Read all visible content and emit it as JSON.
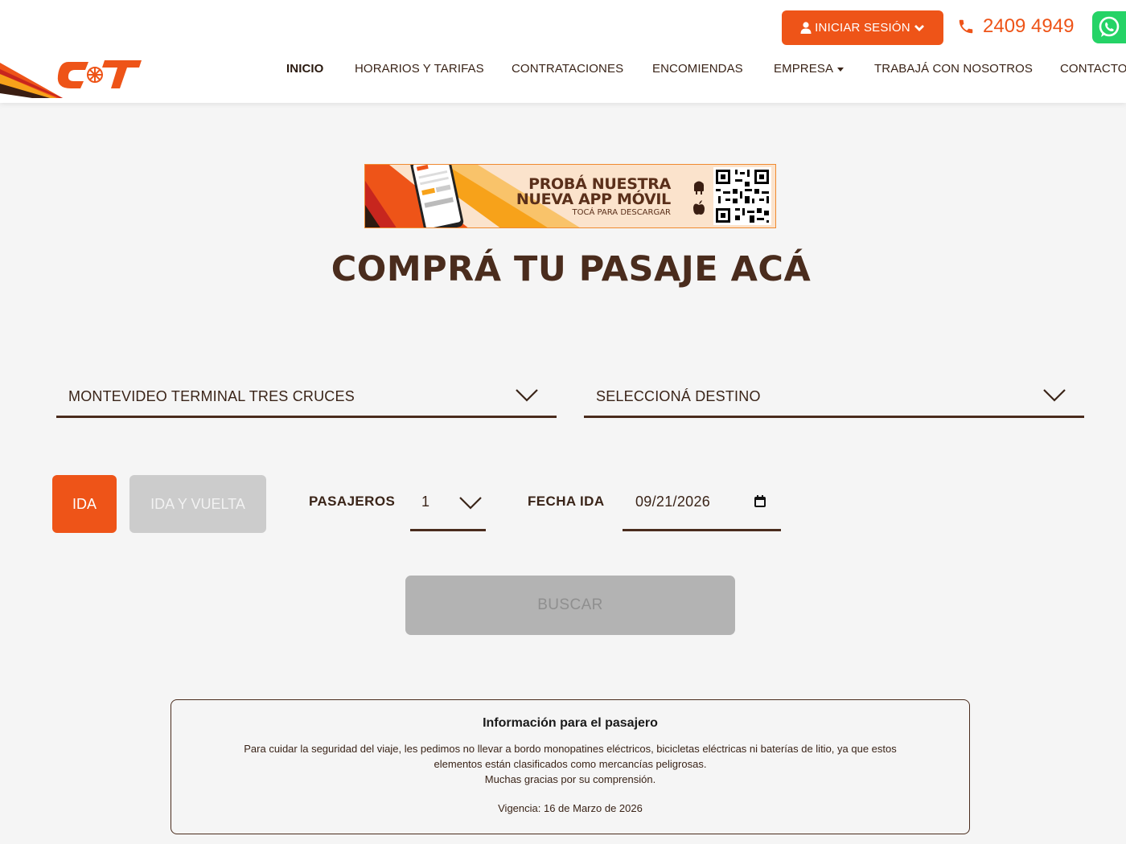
{
  "header": {
    "login_label": "INICIAR SESIÓN",
    "phone": "2409 4949",
    "nav": [
      {
        "label": "INICIO",
        "active": true
      },
      {
        "label": "HORARIOS Y TARIFAS"
      },
      {
        "label": "CONTRATACIONES"
      },
      {
        "label": "ENCOMIENDAS"
      },
      {
        "label": "EMPRESA"
      },
      {
        "label": "TRABAJÁ CON NOSOTROS"
      },
      {
        "label": "CONTACTO"
      }
    ]
  },
  "banner": {
    "title_line1": "PROBÁ NUESTRA",
    "title_line2": "NUEVA APP MÓVIL",
    "subtitle": "TOCÁ PARA DESCARGAR"
  },
  "main": {
    "title": "COMPRÁ TU PASAJE ACÁ"
  },
  "search": {
    "origin": "MONTEVIDEO TERMINAL TRES CRUCES",
    "destination": "SELECCIONÁ DESTINO",
    "trip_ida": "IDA",
    "trip_ida_vuelta": "IDA Y VUELTA",
    "passengers_label": "PASAJEROS",
    "passengers_value": "1",
    "date_label": "FECHA IDA",
    "date_value": "09/21/2026",
    "search_button": "BUSCAR"
  },
  "info": {
    "title": "Información para el pasajero",
    "line1": "Para cuidar la seguridad del viaje, les pedimos no llevar a bordo monopatines eléctricos, bicicletas eléctricas ni baterías de litio, ya que estos",
    "line2": "elementos están clasificados como mercancías peligrosas.",
    "line3": "Muchas gracias por su comprensión.",
    "validity": "Vigencia: 16 de Marzo de 2026"
  },
  "colors": {
    "accent": "#ee5418",
    "brown": "#4a2c1d",
    "whatsapp": "#25d366"
  }
}
